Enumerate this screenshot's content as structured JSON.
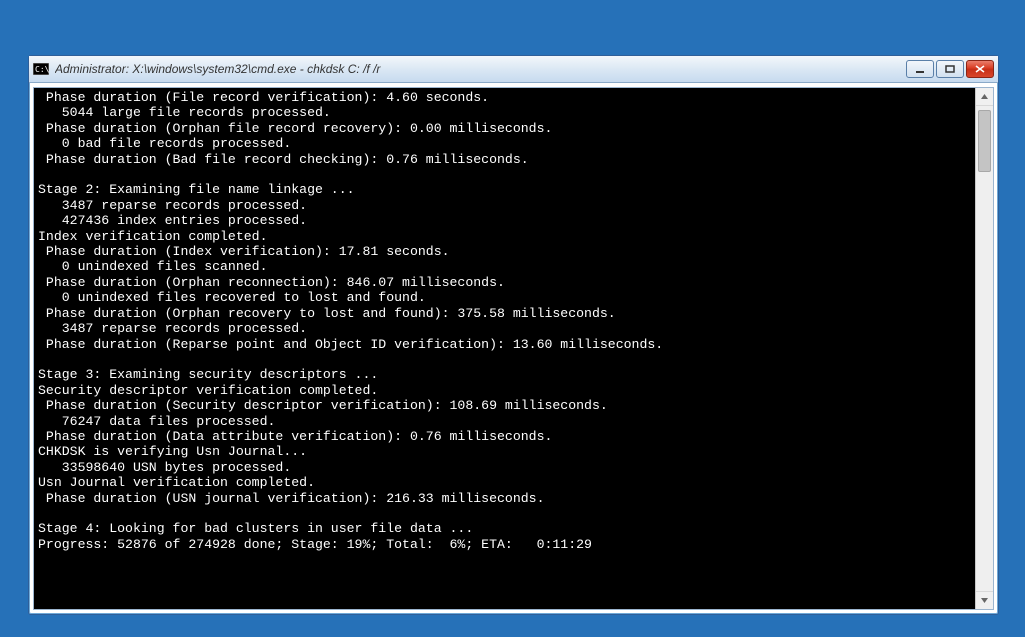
{
  "window": {
    "title": "Administrator:  X:\\windows\\system32\\cmd.exe - chkdsk  C: /f /r"
  },
  "console": {
    "lines": [
      " Phase duration (File record verification): 4.60 seconds.",
      "   5044 large file records processed.",
      " Phase duration (Orphan file record recovery): 0.00 milliseconds.",
      "   0 bad file records processed.",
      " Phase duration (Bad file record checking): 0.76 milliseconds.",
      "",
      "Stage 2: Examining file name linkage ...",
      "   3487 reparse records processed.",
      "   427436 index entries processed.",
      "Index verification completed.",
      " Phase duration (Index verification): 17.81 seconds.",
      "   0 unindexed files scanned.",
      " Phase duration (Orphan reconnection): 846.07 milliseconds.",
      "   0 unindexed files recovered to lost and found.",
      " Phase duration (Orphan recovery to lost and found): 375.58 milliseconds.",
      "   3487 reparse records processed.",
      " Phase duration (Reparse point and Object ID verification): 13.60 milliseconds.",
      "",
      "Stage 3: Examining security descriptors ...",
      "Security descriptor verification completed.",
      " Phase duration (Security descriptor verification): 108.69 milliseconds.",
      "   76247 data files processed.",
      " Phase duration (Data attribute verification): 0.76 milliseconds.",
      "CHKDSK is verifying Usn Journal...",
      "   33598640 USN bytes processed.",
      "Usn Journal verification completed.",
      " Phase duration (USN journal verification): 216.33 milliseconds.",
      "",
      "Stage 4: Looking for bad clusters in user file data ...",
      "Progress: 52876 of 274928 done; Stage: 19%; Total:  6%; ETA:   0:11:29"
    ]
  }
}
